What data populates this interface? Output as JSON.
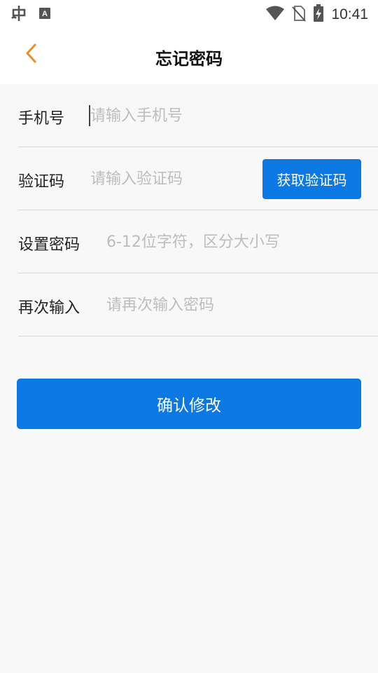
{
  "status_bar": {
    "time": "10:41",
    "icons_left": [
      "bug-app-icon",
      "a-keyboard-icon"
    ],
    "icons_right": [
      "wifi-icon",
      "no-sim-icon",
      "battery-charging-icon"
    ]
  },
  "app_bar": {
    "title": "忘记密码",
    "back_icon": "chevron-left-icon",
    "accent_color": "#f08a24"
  },
  "form": {
    "phone": {
      "label": "手机号",
      "placeholder": "请输入手机号",
      "value": ""
    },
    "code": {
      "label": "验证码",
      "placeholder": "请输入验证码",
      "value": "",
      "button_label": "获取验证码"
    },
    "password": {
      "label": "设置密码",
      "placeholder": "6-12位字符，区分大小写",
      "value": ""
    },
    "confirm": {
      "label": "再次输入",
      "placeholder": "请再次输入密码",
      "value": ""
    }
  },
  "submit": {
    "label": "确认修改"
  },
  "colors": {
    "primary": "#0b78e3",
    "background": "#f8f8f8",
    "divider": "#d6d6d6",
    "placeholder": "#bdbdbd"
  }
}
